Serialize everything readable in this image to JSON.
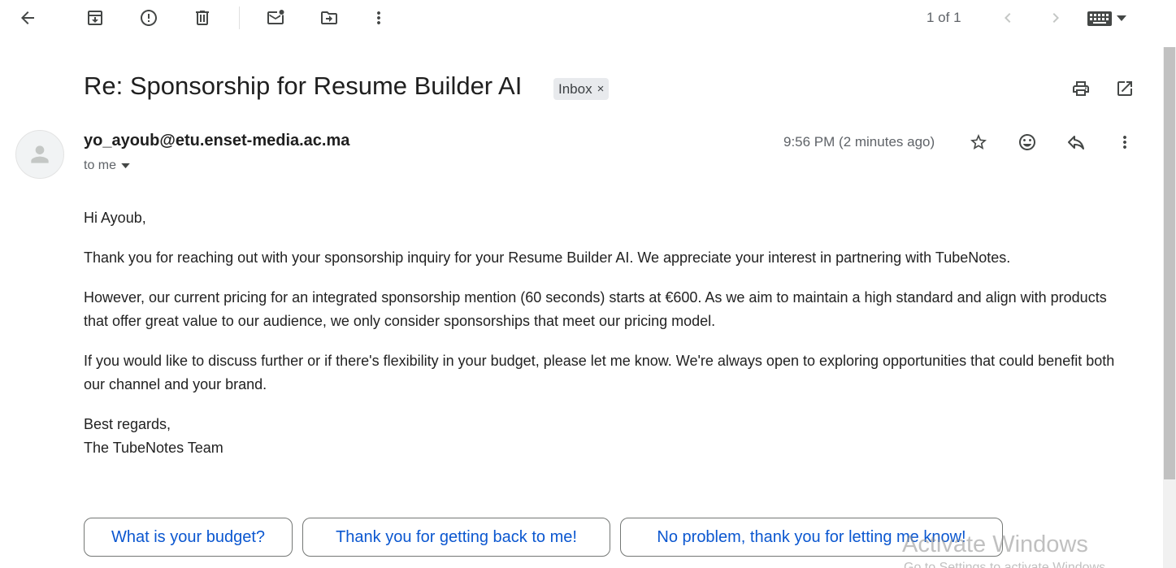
{
  "toolbar": {
    "back_icon": "arrow-left-icon",
    "archive_icon": "archive-icon",
    "spam_icon": "report-spam-icon",
    "delete_icon": "trash-icon",
    "unread_icon": "mark-unread-icon",
    "move_icon": "move-to-icon",
    "more_icon": "more-vertical-icon",
    "pager_text": "1 of 1",
    "prev_icon": "chevron-left-icon",
    "next_icon": "chevron-right-icon",
    "keyboard_icon": "keyboard-icon"
  },
  "email": {
    "subject": "Re: Sponsorship for Resume Builder AI",
    "label": "Inbox",
    "label_remove": "×",
    "sender": "yo_ayoub@etu.enset-media.ac.ma",
    "recipient": "to me",
    "timestamp": "9:56 PM (2 minutes ago)",
    "greeting": "Hi Ayoub,",
    "paragraphs": [
      "Thank you for reaching out with your sponsorship inquiry for your Resume Builder AI. We appreciate your interest in partnering with TubeNotes.",
      "However, our current pricing for an integrated sponsorship mention (60 seconds) starts at €600. As we aim to maintain a high standard and align with products that offer great value to our audience, we only consider sponsorships that meet our pricing model.",
      "If you would like to discuss further or if there's flexibility in your budget, please let me know. We're always open to exploring opportunities that could benefit both our channel and your brand."
    ],
    "closing": "Best regards,",
    "signature": "The TubeNotes Team"
  },
  "smart_replies": [
    "What is your budget?",
    "Thank you for getting back to me!",
    "No problem, thank you for letting me know!"
  ],
  "watermark": {
    "title": "Activate Windows",
    "subtitle": "Go to Settings to activate Windows."
  },
  "colors": {
    "accent": "#0b57d0",
    "text": "#1f1f1f",
    "muted": "#5f6368"
  }
}
